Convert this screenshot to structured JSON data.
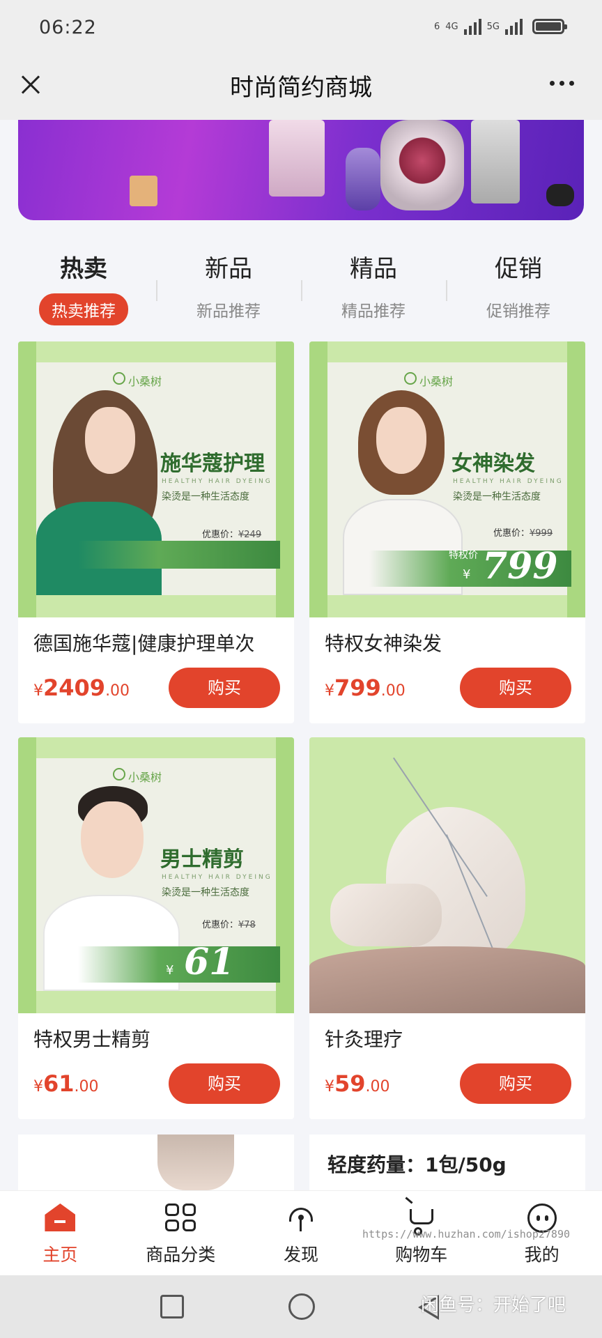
{
  "status_bar": {
    "time": "06:22",
    "net1": "6",
    "net2": "4G",
    "net3": "5G"
  },
  "header": {
    "title": "时尚简约商城",
    "close_icon": "close-icon",
    "more_icon": "more-dots-icon"
  },
  "tabs": [
    {
      "title": "热卖",
      "sub": "热卖推荐",
      "active": true
    },
    {
      "title": "新品",
      "sub": "新品推荐",
      "active": false
    },
    {
      "title": "精品",
      "sub": "精品推荐",
      "active": false
    },
    {
      "title": "促销",
      "sub": "促销推荐",
      "active": false
    }
  ],
  "products": [
    {
      "name": "德国施华蔻|健康护理单次",
      "currency": "¥",
      "price_int": "2409",
      "price_dec": ".00",
      "buy_label": "购买",
      "poster": {
        "brand": "小桑树",
        "title": "施华蔻护理",
        "en": "HEALTHY HAIR DYEING",
        "slogan": "染烫是一种生活态度",
        "orig": "优惠价：",
        "orig_price": "¥249",
        "tp_label": "",
        "tp_price": ""
      }
    },
    {
      "name": "特权女神染发",
      "currency": "¥",
      "price_int": "799",
      "price_dec": ".00",
      "buy_label": "购买",
      "poster": {
        "brand": "小桑树",
        "title": "女神染发",
        "en": "HEALTHY HAIR DYEING",
        "slogan": "染烫是一种生活态度",
        "orig": "优惠价：",
        "orig_price": "¥999",
        "tp_label": "特权价",
        "tp_price": "799",
        "tp_cur": "¥"
      }
    },
    {
      "name": "特权男士精剪",
      "currency": "¥",
      "price_int": "61",
      "price_dec": ".00",
      "buy_label": "购买",
      "poster": {
        "brand": "小桑树",
        "title": "男士精剪",
        "en": "HEALTHY HAIR DYEING",
        "slogan": "染烫是一种生活态度",
        "orig": "优惠价：",
        "orig_price": "¥78",
        "tp_label": "特权价",
        "tp_price": "61",
        "tp_cur": "¥"
      }
    },
    {
      "name": "针灸理疗",
      "currency": "¥",
      "price_int": "59",
      "price_dec": ".00",
      "buy_label": "购买"
    }
  ],
  "partial_row": {
    "right_text": "轻度药量：1包/50g"
  },
  "bottom_nav": [
    {
      "label": "主页",
      "icon": "home-icon",
      "active": true
    },
    {
      "label": "商品分类",
      "icon": "category-grid-icon",
      "active": false
    },
    {
      "label": "发现",
      "icon": "discover-icon",
      "active": false
    },
    {
      "label": "购物车",
      "icon": "cart-icon",
      "active": false
    },
    {
      "label": "我的",
      "icon": "profile-icon",
      "active": false
    }
  ],
  "watermark": "https://www.huzhan.com/ishop27890",
  "system_watermark": "闲鱼号：开始了吧",
  "colors": {
    "accent": "#e2442c",
    "poster_green": "#3d8a40"
  }
}
